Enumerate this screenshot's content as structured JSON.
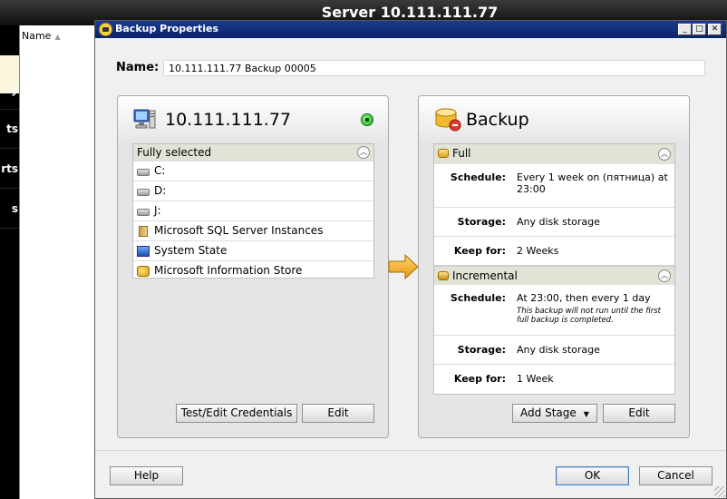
{
  "background": {
    "title": "Server 10.111.111.77",
    "nav_items": [
      "y",
      "ts",
      "rts",
      "s"
    ],
    "list_column": "Name"
  },
  "dialog": {
    "title": "Backup Properties",
    "name_label": "Name:",
    "name_value": "10.111.111.77 Backup 00005"
  },
  "source": {
    "title": "10.111.111.77",
    "section": "Fully selected",
    "items": [
      {
        "label": "C:",
        "icon": "drive-icon"
      },
      {
        "label": "D:",
        "icon": "drive-icon"
      },
      {
        "label": "J:",
        "icon": "drive-icon"
      },
      {
        "label": "Microsoft SQL Server Instances",
        "icon": "sql-server-icon"
      },
      {
        "label": "System State",
        "icon": "system-state-icon"
      },
      {
        "label": "Microsoft Information Store",
        "icon": "exchange-store-icon"
      }
    ],
    "credentials_button": "Test/Edit Credentials",
    "edit_button": "Edit"
  },
  "backup": {
    "title": "Backup",
    "stages": [
      {
        "name": "Full",
        "schedule_label": "Schedule:",
        "schedule": "Every 1 week on (пятница) at 23:00",
        "storage_label": "Storage:",
        "storage": "Any disk storage",
        "keep_label": "Keep for:",
        "keep": "2 Weeks"
      },
      {
        "name": "Incremental",
        "schedule_label": "Schedule:",
        "schedule": "At 23:00, then every 1 day",
        "note": "This backup will not run until the first full backup is completed.",
        "storage_label": "Storage:",
        "storage": "Any disk storage",
        "keep_label": "Keep for:",
        "keep": "1 Week"
      }
    ],
    "add_stage_button": "Add Stage",
    "edit_button": "Edit"
  },
  "footer": {
    "help": "Help",
    "ok": "OK",
    "cancel": "Cancel"
  },
  "colors": {
    "titlebar": "#0a246a",
    "panel_header": "#e1e3d6",
    "status_online": "#1ea41e",
    "arrow": "#f5b42c"
  }
}
